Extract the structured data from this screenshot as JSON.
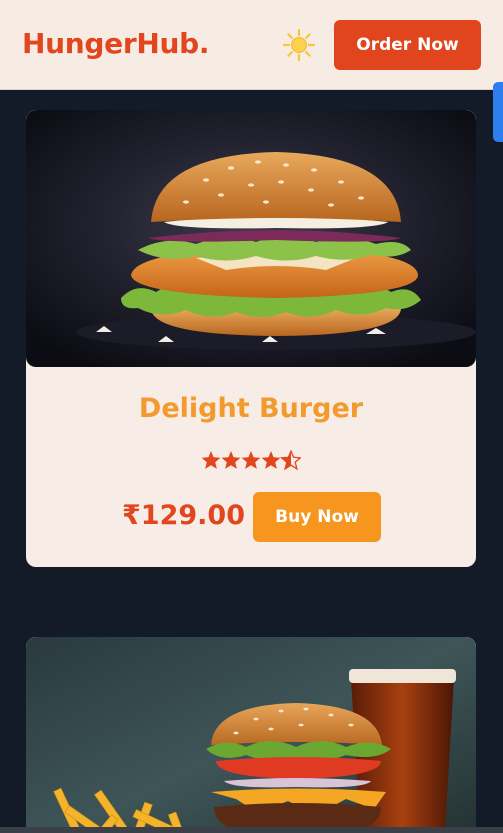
{
  "header": {
    "logo": "HungerHub.",
    "theme_icon": "sun-icon",
    "order_button": "Order Now"
  },
  "cards": [
    {
      "image": "burger-photo",
      "title": "Delight Burger",
      "rating": 4.5,
      "rating_max": 5,
      "price": "₹129.00",
      "buy_button": "Buy Now"
    },
    {
      "image": "burger-fries-drink-photo"
    }
  ],
  "colors": {
    "accent_red": "#e2461f",
    "accent_orange": "#f6961f",
    "card_bg": "#f7ede6",
    "page_bg": "#131a28"
  }
}
